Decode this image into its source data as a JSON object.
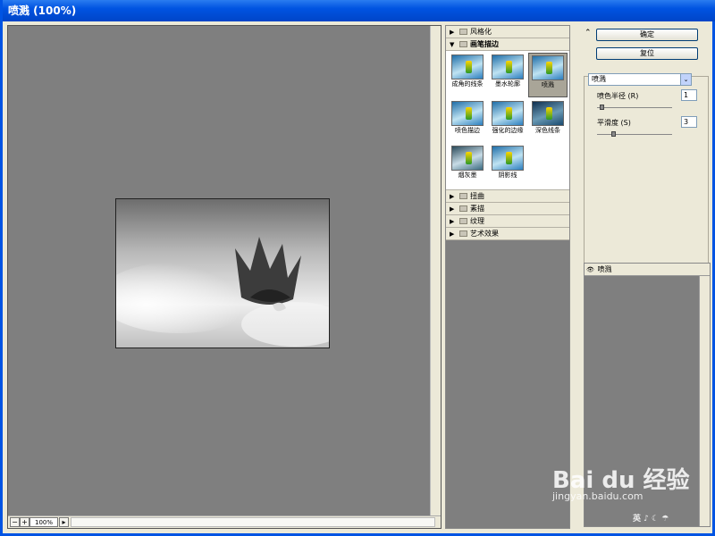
{
  "window": {
    "title": "喷溅 (100%)"
  },
  "preview": {
    "zoom": "100%",
    "zoom_out": "−",
    "zoom_in": "+"
  },
  "gallery": {
    "categories_top": [
      {
        "label": "风格化",
        "arrow": "▶"
      }
    ],
    "open_category": {
      "label": "画笔描边",
      "arrow": "▼"
    },
    "thumbnails": [
      {
        "label": "成角的线条"
      },
      {
        "label": "墨水轮廓"
      },
      {
        "label": "喷溅",
        "selected": true
      },
      {
        "label": "喷色描边"
      },
      {
        "label": "强化的边缘"
      },
      {
        "label": "深色线条"
      },
      {
        "label": "烟灰墨"
      },
      {
        "label": "阴影线"
      }
    ],
    "categories_bottom": [
      {
        "label": "扭曲",
        "arrow": "▶"
      },
      {
        "label": "素描",
        "arrow": "▶"
      },
      {
        "label": "纹理",
        "arrow": "▶"
      },
      {
        "label": "艺术效果",
        "arrow": "▶"
      }
    ]
  },
  "buttons": {
    "ok": "确定",
    "reset": "复位",
    "collapse": "⌃"
  },
  "settings": {
    "filter": "喷溅",
    "filter_arrow": "⌄",
    "spray_radius_label": "喷色半径 (R)",
    "spray_radius_value": "1",
    "spray_radius_max": 25,
    "smoothness_label": "平滑度 (S)",
    "smoothness_value": "3",
    "smoothness_max": 15
  },
  "layers": {
    "eye": "👁",
    "name": "喷溅"
  },
  "watermark": {
    "logo": "Bai du 经验",
    "url": "jingyan.baidu.com",
    "small": "英 ♪ ☾ ☂"
  }
}
